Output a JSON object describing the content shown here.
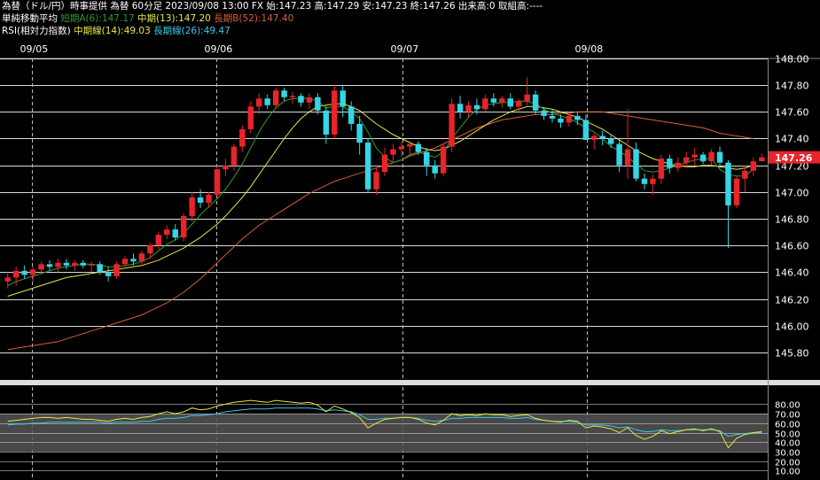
{
  "header": {
    "line1": "為替（ドル/円）時事提供 為替 60分足 2023/09/08 13:00 FX 始:147.23 高:147.29 安:147.23 終:147.26 出来高:0 取組高:----",
    "ma_title": "単純移動平均",
    "ma_short": "短期A(6):147.17",
    "ma_mid": "中期(13):147.20",
    "ma_long": "長期B(52):147.40",
    "rsi_title": "RSI(相対力指数)",
    "rsi_mid": "中期線(14):49.03",
    "rsi_long": "長期線(26):49.47"
  },
  "colors": {
    "up": "#e8242a",
    "down": "#34d6e6",
    "ma_short": "#2e9a2e",
    "ma_mid": "#e6e645",
    "ma_long": "#d6603a",
    "price_tag": "#e8242a",
    "grid": "#ffffff",
    "dashed": "#bbbbbb"
  },
  "chart_data": [
    {
      "type": "candlestick",
      "x_labels": [
        "09/05",
        "09/06",
        "09/07",
        "09/08"
      ],
      "ylim": [
        145.6,
        148.0
      ],
      "y_ticks": [
        "148.00",
        "147.80",
        "147.60",
        "147.40",
        "147.20",
        "147.00",
        "146.80",
        "146.60",
        "146.40",
        "146.20",
        "146.00",
        "145.80"
      ],
      "last_price": "147.26",
      "candles": [
        [
          146.33,
          146.4,
          146.28,
          146.36
        ],
        [
          146.36,
          146.44,
          146.3,
          146.41
        ],
        [
          146.41,
          146.45,
          146.35,
          146.38
        ],
        [
          146.38,
          146.44,
          146.33,
          146.42
        ],
        [
          146.42,
          146.48,
          146.38,
          146.46
        ],
        [
          146.46,
          146.49,
          146.41,
          146.44
        ],
        [
          146.44,
          146.5,
          146.4,
          146.47
        ],
        [
          146.47,
          146.5,
          146.42,
          146.45
        ],
        [
          146.45,
          146.49,
          146.41,
          146.47
        ],
        [
          146.47,
          146.49,
          146.43,
          146.45
        ],
        [
          146.45,
          146.48,
          146.4,
          146.46
        ],
        [
          146.46,
          146.48,
          146.38,
          146.4
        ],
        [
          146.4,
          146.44,
          146.33,
          146.37
        ],
        [
          146.37,
          146.48,
          146.35,
          146.46
        ],
        [
          146.46,
          146.52,
          146.43,
          146.5
        ],
        [
          146.5,
          146.54,
          146.45,
          146.48
        ],
        [
          146.48,
          146.56,
          146.46,
          146.54
        ],
        [
          146.54,
          146.62,
          146.5,
          146.6
        ],
        [
          146.6,
          146.7,
          146.57,
          146.68
        ],
        [
          146.68,
          146.75,
          146.65,
          146.72
        ],
        [
          146.72,
          146.76,
          146.64,
          146.66
        ],
        [
          146.66,
          146.84,
          146.63,
          146.82
        ],
        [
          146.82,
          147.0,
          146.78,
          146.96
        ],
        [
          146.96,
          147.02,
          146.88,
          146.92
        ],
        [
          146.92,
          147.0,
          146.88,
          146.98
        ],
        [
          146.98,
          147.2,
          146.95,
          147.17
        ],
        [
          147.17,
          147.25,
          147.12,
          147.2
        ],
        [
          147.2,
          147.36,
          147.16,
          147.34
        ],
        [
          147.34,
          147.5,
          147.3,
          147.47
        ],
        [
          147.47,
          147.68,
          147.44,
          147.64
        ],
        [
          147.64,
          147.74,
          147.58,
          147.7
        ],
        [
          147.7,
          147.73,
          147.62,
          147.65
        ],
        [
          147.65,
          147.78,
          147.62,
          147.76
        ],
        [
          147.76,
          147.78,
          147.68,
          147.71
        ],
        [
          147.71,
          147.75,
          147.66,
          147.72
        ],
        [
          147.72,
          147.74,
          147.64,
          147.67
        ],
        [
          147.67,
          147.74,
          147.62,
          147.71
        ],
        [
          147.71,
          147.74,
          147.58,
          147.61
        ],
        [
          147.61,
          147.64,
          147.36,
          147.43
        ],
        [
          147.43,
          147.8,
          147.4,
          147.76
        ],
        [
          147.76,
          147.8,
          147.56,
          147.64
        ],
        [
          147.64,
          147.68,
          147.46,
          147.51
        ],
        [
          147.51,
          147.57,
          147.28,
          147.37
        ],
        [
          147.37,
          147.4,
          147.0,
          147.02
        ],
        [
          147.02,
          147.18,
          146.98,
          147.15
        ],
        [
          147.15,
          147.33,
          147.12,
          147.28
        ],
        [
          147.28,
          147.36,
          147.22,
          147.32
        ],
        [
          147.32,
          147.38,
          147.26,
          147.34
        ],
        [
          147.34,
          147.38,
          147.28,
          147.36
        ],
        [
          147.36,
          147.38,
          147.28,
          147.3
        ],
        [
          147.3,
          147.33,
          147.12,
          147.2
        ],
        [
          147.2,
          147.24,
          147.1,
          147.14
        ],
        [
          147.14,
          147.36,
          147.12,
          147.34
        ],
        [
          147.34,
          147.7,
          147.3,
          147.66
        ],
        [
          147.66,
          147.72,
          147.55,
          147.6
        ],
        [
          147.6,
          147.68,
          147.56,
          147.65
        ],
        [
          147.65,
          147.7,
          147.58,
          147.62
        ],
        [
          147.62,
          147.73,
          147.6,
          147.7
        ],
        [
          147.7,
          147.74,
          147.64,
          147.67
        ],
        [
          147.67,
          147.72,
          147.63,
          147.7
        ],
        [
          147.7,
          147.74,
          147.62,
          147.64
        ],
        [
          147.64,
          147.7,
          147.6,
          147.68
        ],
        [
          147.68,
          147.86,
          147.65,
          147.73
        ],
        [
          147.73,
          147.76,
          147.58,
          147.61
        ],
        [
          147.61,
          147.63,
          147.54,
          147.57
        ],
        [
          147.57,
          147.62,
          147.52,
          147.55
        ],
        [
          147.55,
          147.58,
          147.48,
          147.52
        ],
        [
          147.52,
          147.6,
          147.49,
          147.57
        ],
        [
          147.57,
          147.6,
          147.5,
          147.54
        ],
        [
          147.54,
          147.58,
          147.44,
          147.39
        ],
        [
          147.39,
          147.44,
          147.32,
          147.42
        ],
        [
          147.42,
          147.46,
          147.35,
          147.4
        ],
        [
          147.4,
          147.43,
          147.33,
          147.36
        ],
        [
          147.36,
          147.4,
          147.15,
          147.2
        ],
        [
          147.2,
          147.62,
          147.1,
          147.32
        ],
        [
          147.32,
          147.37,
          147.08,
          147.1
        ],
        [
          147.1,
          147.14,
          147.02,
          147.06
        ],
        [
          147.06,
          147.13,
          146.98,
          147.1
        ],
        [
          147.1,
          147.28,
          147.06,
          147.25
        ],
        [
          147.25,
          147.28,
          147.14,
          147.18
        ],
        [
          147.18,
          147.26,
          147.15,
          147.22
        ],
        [
          147.22,
          147.3,
          147.18,
          147.26
        ],
        [
          147.26,
          147.33,
          147.2,
          147.28
        ],
        [
          147.28,
          147.3,
          147.21,
          147.23
        ],
        [
          147.23,
          147.32,
          147.2,
          147.3
        ],
        [
          147.3,
          147.34,
          147.18,
          147.22
        ],
        [
          147.22,
          147.24,
          146.58,
          146.9
        ],
        [
          146.9,
          147.12,
          146.88,
          147.1
        ],
        [
          147.1,
          147.2,
          147.0,
          147.16
        ],
        [
          147.16,
          147.26,
          147.12,
          147.23
        ],
        [
          147.23,
          147.29,
          147.23,
          147.26
        ]
      ],
      "ma_short": [
        146.3,
        146.33,
        146.35,
        146.37,
        146.39,
        146.41,
        146.43,
        146.44,
        146.45,
        146.46,
        146.46,
        146.45,
        146.44,
        146.44,
        146.45,
        146.46,
        146.48,
        146.51,
        146.56,
        146.61,
        146.64,
        146.69,
        146.76,
        146.83,
        146.89,
        146.95,
        147.02,
        147.11,
        147.21,
        147.33,
        147.45,
        147.55,
        147.63,
        147.68,
        147.7,
        147.7,
        147.7,
        147.68,
        147.63,
        147.64,
        147.64,
        147.6,
        147.55,
        147.45,
        147.33,
        147.26,
        147.22,
        147.24,
        147.28,
        147.3,
        147.28,
        147.26,
        147.3,
        147.4,
        147.48,
        147.56,
        147.62,
        147.65,
        147.66,
        147.67,
        147.67,
        147.68,
        147.68,
        147.66,
        147.62,
        147.59,
        147.57,
        147.55,
        147.52,
        147.48,
        147.45,
        147.4,
        147.34,
        147.31,
        147.26,
        147.21,
        147.16,
        147.15,
        147.16,
        147.18,
        147.2,
        147.22,
        147.24,
        147.25,
        147.25,
        147.17,
        147.13,
        147.12,
        147.12,
        147.17
      ],
      "ma_mid": [
        146.22,
        146.24,
        146.26,
        146.28,
        146.3,
        146.32,
        146.34,
        146.36,
        146.37,
        146.38,
        146.39,
        146.4,
        146.41,
        146.42,
        146.43,
        146.44,
        146.45,
        146.47,
        146.49,
        146.52,
        146.55,
        146.58,
        146.62,
        146.66,
        146.71,
        146.76,
        146.82,
        146.89,
        146.96,
        147.04,
        147.13,
        147.22,
        147.31,
        147.4,
        147.48,
        147.55,
        147.6,
        147.64,
        147.65,
        147.66,
        147.66,
        147.64,
        147.61,
        147.56,
        147.51,
        147.47,
        147.43,
        147.4,
        147.37,
        147.34,
        147.32,
        147.31,
        147.32,
        147.35,
        147.38,
        147.42,
        147.46,
        147.5,
        147.54,
        147.57,
        147.6,
        147.62,
        147.64,
        147.64,
        147.63,
        147.62,
        147.6,
        147.58,
        147.56,
        147.53,
        147.5,
        147.47,
        147.43,
        147.39,
        147.35,
        147.31,
        147.28,
        147.25,
        147.23,
        147.21,
        147.2,
        147.19,
        147.19,
        147.2,
        147.2,
        147.19,
        147.18,
        147.17,
        147.18,
        147.2
      ],
      "ma_long": [
        145.82,
        145.83,
        145.84,
        145.85,
        145.86,
        145.87,
        145.88,
        145.9,
        145.92,
        145.94,
        145.96,
        145.98,
        146.0,
        146.02,
        146.04,
        146.06,
        146.08,
        146.11,
        146.14,
        146.17,
        146.21,
        146.25,
        146.3,
        146.35,
        146.41,
        146.47,
        146.53,
        146.59,
        146.65,
        146.7,
        146.75,
        146.79,
        146.83,
        146.87,
        146.91,
        146.95,
        146.99,
        147.02,
        147.05,
        147.08,
        147.1,
        147.12,
        147.14,
        147.16,
        147.18,
        147.2,
        147.22,
        147.24,
        147.27,
        147.29,
        147.31,
        147.33,
        147.36,
        147.39,
        147.42,
        147.45,
        147.48,
        147.5,
        147.52,
        147.54,
        147.55,
        147.56,
        147.57,
        147.58,
        147.58,
        147.58,
        147.59,
        147.59,
        147.6,
        147.6,
        147.6,
        147.6,
        147.59,
        147.58,
        147.57,
        147.56,
        147.55,
        147.54,
        147.53,
        147.52,
        147.51,
        147.5,
        147.49,
        147.48,
        147.46,
        147.44,
        147.43,
        147.42,
        147.41,
        147.4
      ]
    },
    {
      "type": "line",
      "name_ref": "rsi",
      "ylim": [
        0,
        100
      ],
      "y_ticks": [
        "80.00",
        "70.00",
        "60.00",
        "50.00",
        "40.00",
        "30.00",
        "20.00",
        "10.00"
      ],
      "rsi_mid": [
        62,
        63,
        64,
        65,
        66,
        66,
        65,
        66,
        65,
        64,
        64,
        63,
        62,
        64,
        65,
        64,
        66,
        67,
        70,
        72,
        70,
        72,
        76,
        74,
        75,
        78,
        80,
        82,
        83,
        84,
        83,
        82,
        84,
        83,
        82,
        81,
        82,
        79,
        72,
        78,
        75,
        71,
        66,
        55,
        60,
        64,
        65,
        66,
        66,
        64,
        60,
        58,
        63,
        70,
        68,
        69,
        68,
        70,
        69,
        69,
        67,
        68,
        69,
        65,
        63,
        62,
        61,
        63,
        62,
        55,
        57,
        56,
        54,
        50,
        55,
        47,
        43,
        46,
        52,
        49,
        51,
        53,
        54,
        52,
        54,
        51,
        34,
        44,
        48,
        50,
        51
      ],
      "rsi_long": [
        58,
        59,
        59,
        60,
        60,
        61,
        61,
        61,
        61,
        61,
        61,
        61,
        60,
        61,
        61,
        61,
        62,
        62,
        64,
        65,
        65,
        66,
        68,
        68,
        69,
        70,
        72,
        73,
        74,
        75,
        75,
        75,
        76,
        76,
        76,
        76,
        76,
        75,
        73,
        74,
        73,
        72,
        69,
        64,
        64,
        65,
        65,
        66,
        66,
        65,
        63,
        62,
        63,
        65,
        65,
        66,
        66,
        66,
        66,
        66,
        65,
        65,
        66,
        64,
        63,
        62,
        62,
        62,
        61,
        58,
        58,
        58,
        57,
        55,
        56,
        53,
        51,
        51,
        53,
        52,
        52,
        53,
        53,
        53,
        53,
        52,
        46,
        48,
        49,
        50,
        50
      ]
    }
  ]
}
